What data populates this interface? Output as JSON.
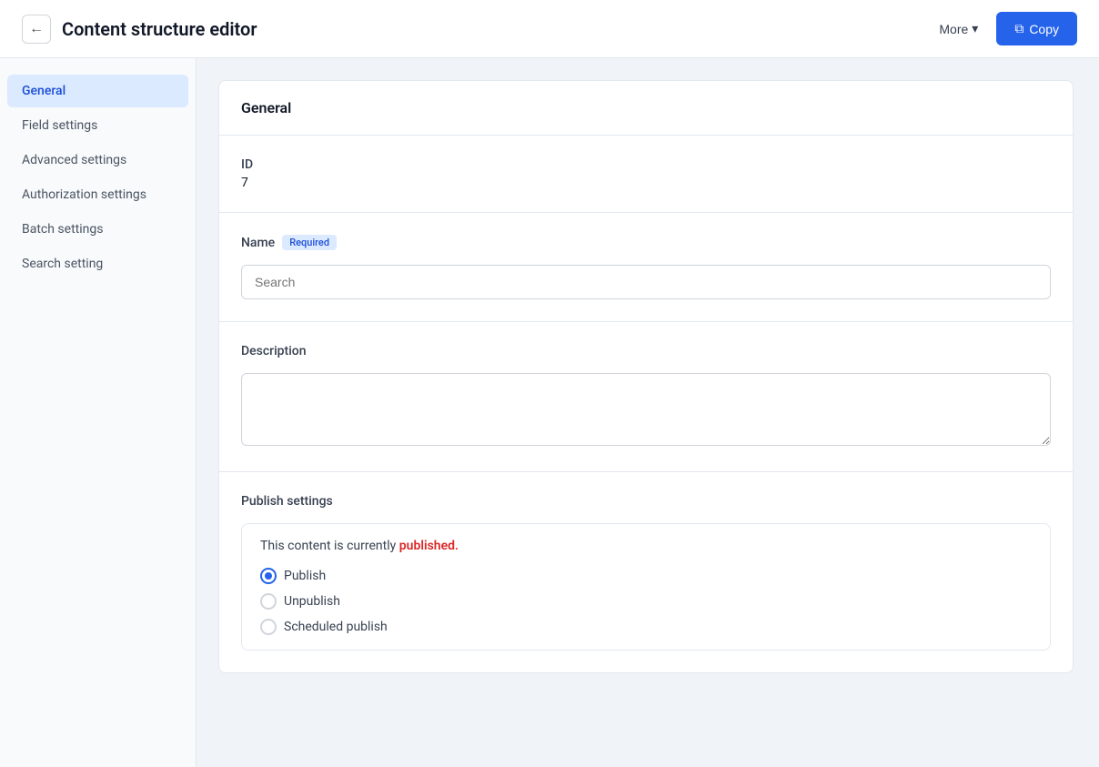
{
  "header": {
    "title": "Content structure editor",
    "back_label": "←",
    "more_label": "More",
    "copy_label": "Copy",
    "copy_icon": "⧉"
  },
  "sidebar": {
    "items": [
      {
        "id": "general",
        "label": "General",
        "active": true
      },
      {
        "id": "field-settings",
        "label": "Field settings",
        "active": false
      },
      {
        "id": "advanced-settings",
        "label": "Advanced settings",
        "active": false
      },
      {
        "id": "authorization-settings",
        "label": "Authorization settings",
        "active": false
      },
      {
        "id": "batch-settings",
        "label": "Batch settings",
        "active": false
      },
      {
        "id": "search-setting",
        "label": "Search setting",
        "active": false
      }
    ]
  },
  "main": {
    "section_title": "General",
    "id_label": "ID",
    "id_value": "7",
    "name_label": "Name",
    "name_required_badge": "Required",
    "name_placeholder": "Search",
    "description_label": "Description",
    "description_placeholder": "",
    "publish_section_title": "Publish settings",
    "publish_status_text_prefix": "This content is currently ",
    "publish_status_word": "published.",
    "publish_options": [
      {
        "id": "publish",
        "label": "Publish",
        "checked": true
      },
      {
        "id": "unpublish",
        "label": "Unpublish",
        "checked": false
      },
      {
        "id": "scheduled-publish",
        "label": "Scheduled publish",
        "checked": false
      }
    ]
  }
}
